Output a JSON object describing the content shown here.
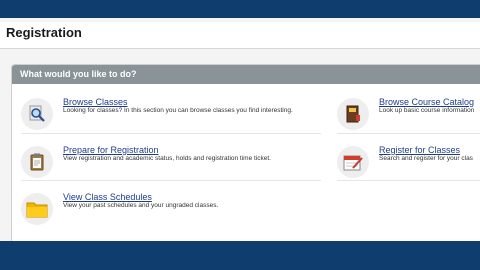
{
  "header": {
    "title": "Registration"
  },
  "panel": {
    "heading": "What would you like to do?"
  },
  "left_items": [
    {
      "label": "Browse Classes",
      "description": "Looking for classes? In this section you can browse classes you find interesting.",
      "icon": "magnifier-icon"
    },
    {
      "label": "Prepare for Registration",
      "description": "View registration and academic status, holds and registration time ticket.",
      "icon": "clipboard-icon"
    },
    {
      "label": "View Class Schedules",
      "description": "View your past schedules and your ungraded classes.",
      "icon": "folder-icon"
    }
  ],
  "right_items": [
    {
      "label": "Browse Course Catalog",
      "description": "Look up basic course information",
      "icon": "book-icon"
    },
    {
      "label": "Register for Classes",
      "description": "Search and register for your clas",
      "icon": "calendar-icon"
    }
  ],
  "colors": {
    "frame_bg": "#0e3d6e",
    "panel_header": "#8a9398",
    "link": "#1f3d8f"
  }
}
